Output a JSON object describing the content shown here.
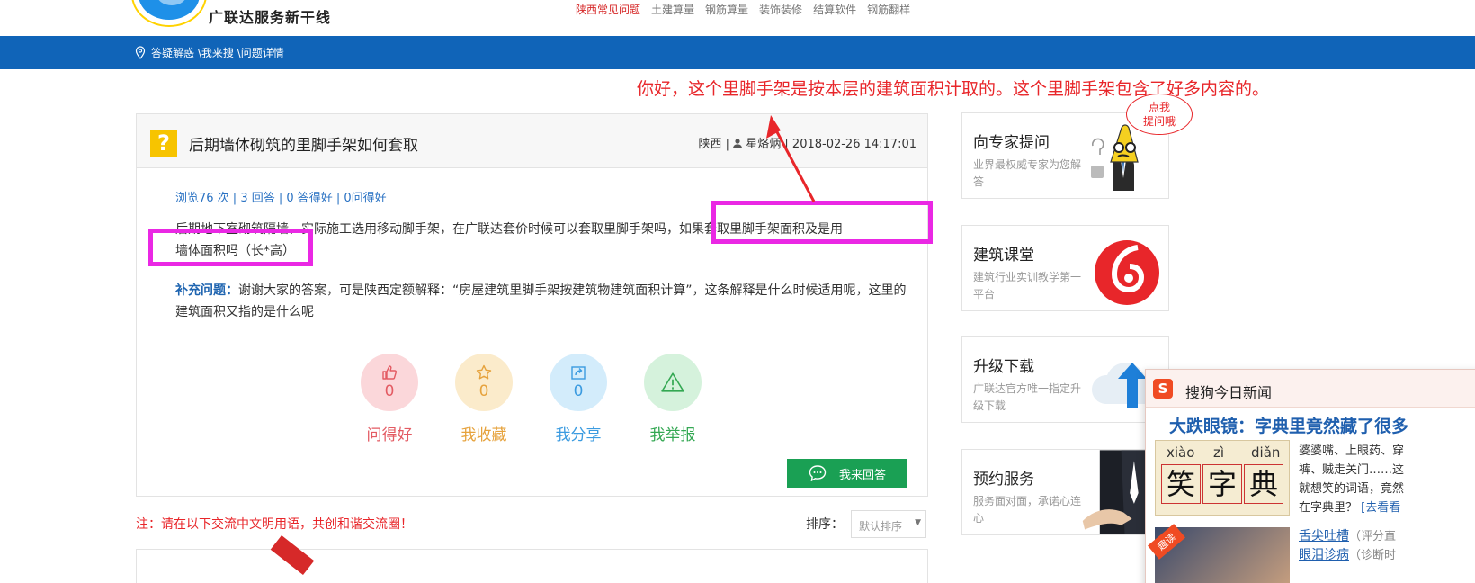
{
  "header": {
    "logo_title": "广联达服务新干线",
    "logo_slogan": "广联达服务新干线",
    "nav": [
      "陕西常见问题",
      "土建算量",
      "钢筋算量",
      "装饰装修",
      "结算软件",
      "钢筋翻样"
    ]
  },
  "breadcrumb": {
    "text": "答疑解惑 \\我来搜 \\问题详情"
  },
  "annotation": {
    "text": "你好，这个里脚手架是按本层的建筑面积计取的。这个里脚手架包含了好多内容的。"
  },
  "question": {
    "title": "后期墙体砌筑的里脚手架如何套取",
    "region": "陕西",
    "author": "星烙炳",
    "datetime": "2018-02-26 14:17:01",
    "stats": "浏览76 次 | 3 回答 | 0 答得好 | 0问得好",
    "body_line1": "后期地下室砌筑隔墙，实际施工选用移动脚手架，在广联达套价时候可以套取里脚手架吗，如果套取里脚手架面积及是用",
    "body_line2": "墙体面积吗（长*高）",
    "supplement_label": "补充问题：",
    "supplement_text": "谢谢大家的答案，可是陕西定额解释：“房屋建筑里脚手架按建筑物建筑面积计算”，这条解释是什么时候适用呢，这里的建筑面积又指的是什么呢"
  },
  "actions": [
    {
      "label": "问得好",
      "count": "0",
      "icon": "thumbs-up-icon"
    },
    {
      "label": "我收藏",
      "count": "0",
      "icon": "star-icon"
    },
    {
      "label": "我分享",
      "count": "0",
      "icon": "share-icon"
    },
    {
      "label": "我举报",
      "count": "0",
      "icon": "warning-icon"
    }
  ],
  "answer_button": "我来回答",
  "notice": "注：请在以下交流中文明用语，共创和谐交流圈！",
  "sort": {
    "label": "排序：",
    "value": "默认排序"
  },
  "sidebar": [
    {
      "title": "向专家提问",
      "desc": "业界最权威专家为您解答"
    },
    {
      "title": "建筑课堂",
      "desc": "建筑行业实训教学第一平台"
    },
    {
      "title": "升级下载",
      "desc": "广联达官方唯一指定升级下载"
    },
    {
      "title": "预约服务",
      "desc": "服务面对面，承诺心连心"
    }
  ],
  "bubble": {
    "line1": "点我",
    "line2": "提问哦"
  },
  "popup": {
    "title": "搜狗今日新闻",
    "headline": "大跌眼镜：字典里竟然藏了很多",
    "dict_pinyin": [
      "xiào",
      "zì",
      "diǎn"
    ],
    "dict_chars": [
      "笑",
      "字",
      "典"
    ],
    "text_lines": [
      "婆婆嘴、上眼药、穿",
      "裤、贼走关门……这",
      "就想笑的词语，竟然",
      "在字典里？"
    ],
    "read_link": "[去看看",
    "thumb_tag": "趣读",
    "list": [
      {
        "link": "舌尖吐槽",
        "meta": "（评分直"
      },
      {
        "link": "眼泪诊病",
        "meta": "（诊断时"
      }
    ]
  }
}
